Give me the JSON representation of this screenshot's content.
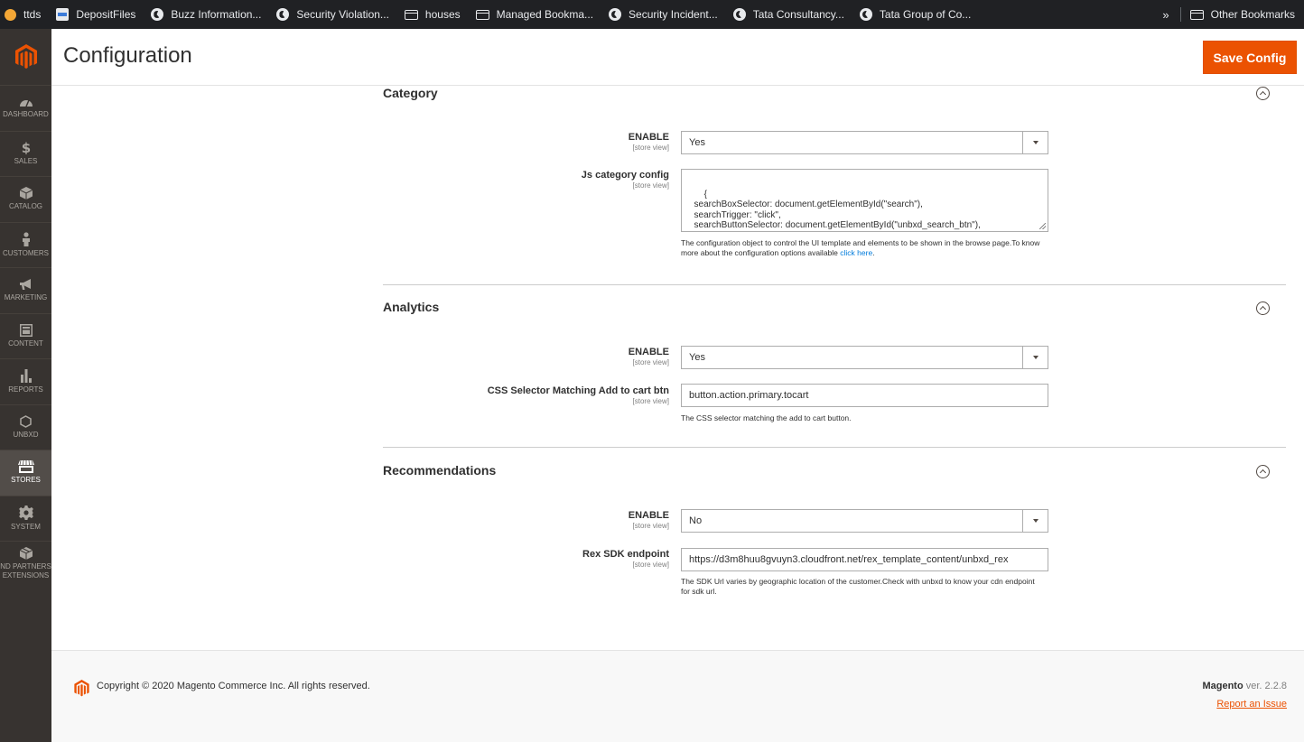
{
  "bookmarks": {
    "items": [
      {
        "label": "ttds",
        "icon": "ttds-favicon-icon"
      },
      {
        "label": "DepositFiles",
        "icon": "depositfiles-favicon-icon"
      },
      {
        "label": "Buzz Information...",
        "icon": "globe-icon"
      },
      {
        "label": "Security Violation...",
        "icon": "globe-icon"
      },
      {
        "label": "houses",
        "icon": "folder-icon"
      },
      {
        "label": "Managed Bookma...",
        "icon": "folder-icon"
      },
      {
        "label": "Security Incident...",
        "icon": "globe-icon"
      },
      {
        "label": "Tata Consultancy...",
        "icon": "globe-icon"
      },
      {
        "label": "Tata Group of Co...",
        "icon": "globe-icon"
      }
    ],
    "more": "»",
    "other": "Other Bookmarks"
  },
  "sidebar": {
    "items": [
      {
        "label": "DASHBOARD",
        "icon": "dashboard-icon"
      },
      {
        "label": "SALES",
        "icon": "dollar-icon"
      },
      {
        "label": "CATALOG",
        "icon": "cube-icon"
      },
      {
        "label": "CUSTOMERS",
        "icon": "person-icon"
      },
      {
        "label": "MARKETING",
        "icon": "megaphone-icon"
      },
      {
        "label": "CONTENT",
        "icon": "layout-icon"
      },
      {
        "label": "REPORTS",
        "icon": "bar-chart-icon"
      },
      {
        "label": "UNBXD",
        "icon": "hexagon-icon"
      },
      {
        "label": "STORES",
        "icon": "store-icon"
      },
      {
        "label": "SYSTEM",
        "icon": "gear-icon"
      },
      {
        "label": "ND PARTNERS",
        "label2": "EXTENSIONS",
        "icon": "box-icon"
      }
    ],
    "active": "STORES"
  },
  "header": {
    "title": "Configuration",
    "save_label": "Save Config"
  },
  "scope_label": "[store view]",
  "category": {
    "title": "Category",
    "enable_label": "ENABLE",
    "enable_value": "Yes",
    "js_label": "Js category config",
    "js_value": "{\n  searchBoxSelector: document.getElementById(\"search\"),\n  searchTrigger: \"click\",\n  searchButtonSelector: document.getElementById(\"unbxd_search_btn\"),\n  searchResultsSelector:",
    "note": "The configuration object to control the UI template and elements to be shown in the browse page.To know more about the configuration options available",
    "note_link": "click here",
    "note_end": "."
  },
  "analytics": {
    "title": "Analytics",
    "enable_label": "ENABLE",
    "enable_value": "Yes",
    "css_label": "CSS Selector Matching Add to cart btn",
    "css_value": "button.action.primary.tocart",
    "note": "The CSS selector matching the add to cart button."
  },
  "recommendations": {
    "title": "Recommendations",
    "enable_label": "ENABLE",
    "enable_value": "No",
    "rex_label": "Rex SDK endpoint",
    "rex_value": "https://d3m8huu8gvuyn3.cloudfront.net/rex_template_content/unbxd_rex",
    "note": "The SDK Url varies by geographic location of the customer.Check with unbxd to know your cdn endpoint for sdk url."
  },
  "footer": {
    "copyright": "Copyright © 2020 Magento Commerce Inc. All rights reserved.",
    "brand": "Magento",
    "version": " ver. 2.2.8",
    "report": "Report an Issue"
  },
  "colors": {
    "accent": "#eb5202",
    "sidebar_bg": "#373330",
    "link": "#007bdb"
  }
}
